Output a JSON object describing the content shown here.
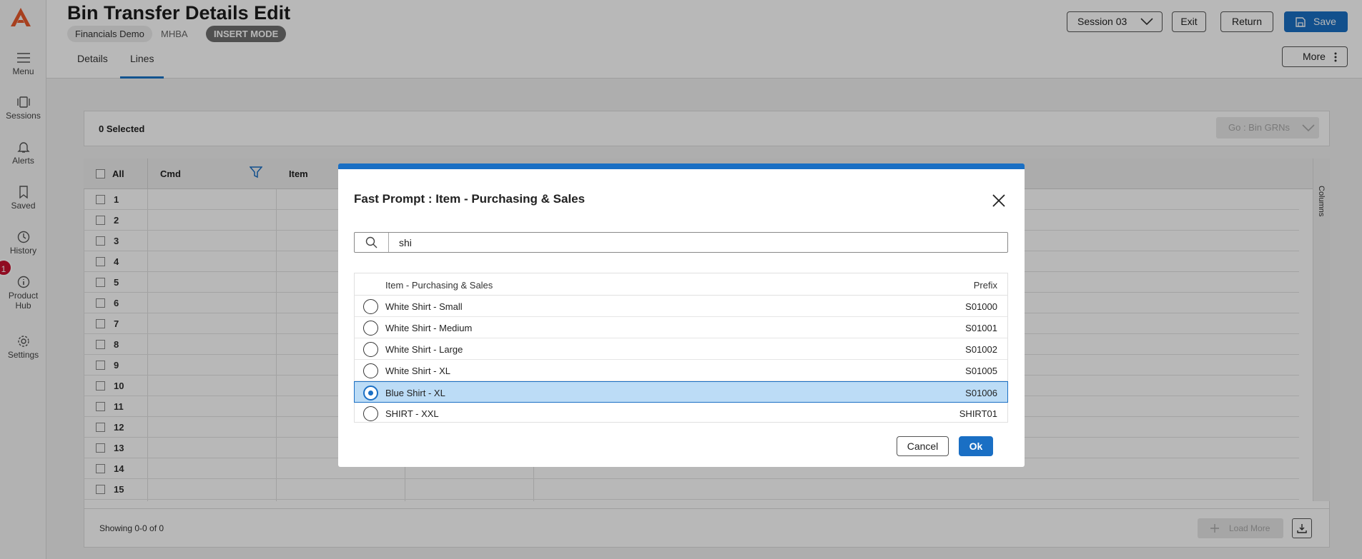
{
  "rail": {
    "items": [
      {
        "label": "Menu"
      },
      {
        "label": "Sessions"
      },
      {
        "label": "Alerts"
      },
      {
        "label": "Saved"
      },
      {
        "label": "History"
      },
      {
        "label": "Product"
      },
      {
        "label": "Hub"
      },
      {
        "label": "Settings"
      }
    ],
    "badge": "1"
  },
  "header": {
    "title": "Bin Transfer Details Edit",
    "company": "Financials Demo",
    "org": "MHBA",
    "mode": "INSERT MODE",
    "session": "Session 03",
    "exit": "Exit",
    "return": "Return",
    "save": "Save",
    "more": "More",
    "tabs": [
      "Details",
      "Lines"
    ]
  },
  "grid": {
    "selected": "0 Selected",
    "go_label": "Go : Bin GRNs",
    "all": "All",
    "columns": [
      "Cmd",
      "Item"
    ],
    "columns_tab": "Columns",
    "rows": [
      "1",
      "2",
      "3",
      "4",
      "5",
      "6",
      "7",
      "8",
      "9",
      "10",
      "11",
      "12",
      "13",
      "14",
      "15"
    ],
    "showing": "Showing 0-0 of 0",
    "load_more": "Load More"
  },
  "dialog": {
    "title": "Fast Prompt : Item - Purchasing & Sales",
    "search_value": "shi",
    "col_item": "Item - Purchasing & Sales",
    "col_prefix": "Prefix",
    "items": [
      {
        "name": "White Shirt - Small",
        "prefix": "S01000"
      },
      {
        "name": "White Shirt - Medium",
        "prefix": "S01001"
      },
      {
        "name": "White Shirt - Large",
        "prefix": "S01002"
      },
      {
        "name": "White Shirt - XL",
        "prefix": "S01005"
      },
      {
        "name": "Blue Shirt - XL",
        "prefix": "S01006"
      },
      {
        "name": "SHIRT - XXL",
        "prefix": "SHIRT01"
      }
    ],
    "selected_index": 4,
    "cancel": "Cancel",
    "ok": "Ok"
  },
  "colors": {
    "accent": "#1a6fc4",
    "logo": "#e8592b",
    "badge": "#c8102e",
    "selected_row": "#bcdcf6"
  }
}
